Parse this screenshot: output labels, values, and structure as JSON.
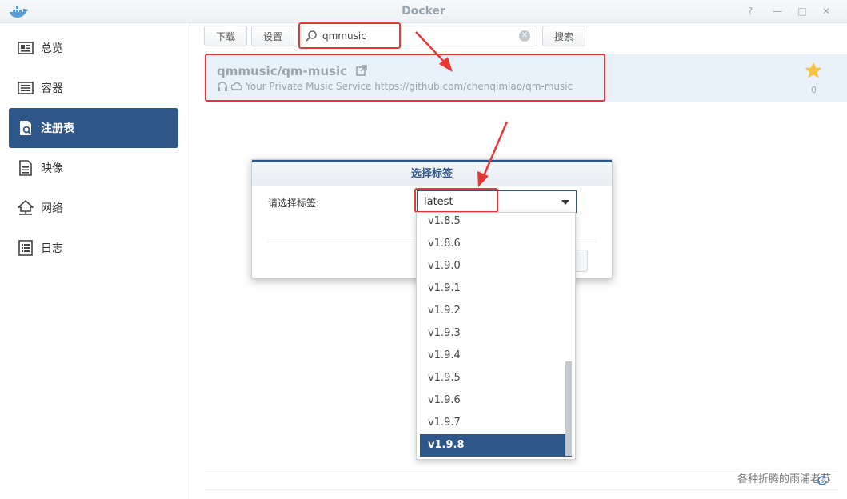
{
  "window": {
    "title": "Docker"
  },
  "sidebar": {
    "items": [
      {
        "label": "总览",
        "icon": "overview-icon"
      },
      {
        "label": "容器",
        "icon": "container-icon"
      },
      {
        "label": "注册表",
        "icon": "registry-icon",
        "active": true
      },
      {
        "label": "映像",
        "icon": "image-icon"
      },
      {
        "label": "网络",
        "icon": "network-icon"
      },
      {
        "label": "日志",
        "icon": "log-icon"
      }
    ]
  },
  "toolbar": {
    "download_label": "下载",
    "settings_label": "设置",
    "search_value": "qmmusic",
    "search_button_label": "搜索"
  },
  "result": {
    "name": "qmmusic/qm-music",
    "description": "Your Private Music Service https://github.com/chenqimiao/qm-music",
    "stars": "0"
  },
  "modal": {
    "title": "选择标签",
    "label": "请选择标签:",
    "selected_value": "latest"
  },
  "dropdown": {
    "options": [
      "v1.8.5",
      "v1.8.6",
      "v1.9.0",
      "v1.9.1",
      "v1.9.2",
      "v1.9.3",
      "v1.9.4",
      "v1.9.5",
      "v1.9.6",
      "v1.9.7",
      "v1.9.8"
    ],
    "highlighted": "v1.9.8"
  },
  "footer": {
    "watermark": "各种折腾的雨浦老苏"
  },
  "colors": {
    "accent": "#2f5688",
    "highlight_red": "#e53935",
    "star": "#f5c342"
  }
}
